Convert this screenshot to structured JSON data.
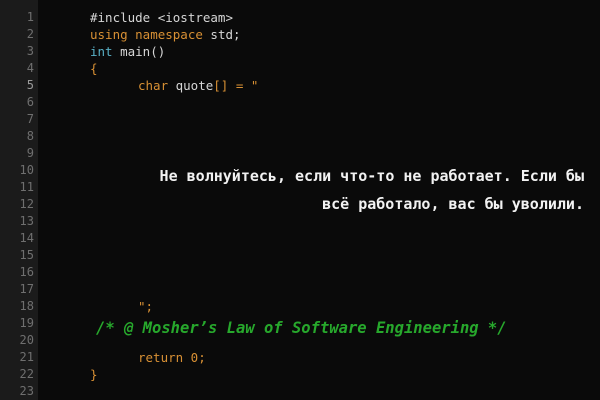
{
  "editor": {
    "line_numbers": [
      "1",
      "2",
      "3",
      "4",
      "5",
      "6",
      "7",
      "8",
      "9",
      "10",
      "11",
      "12",
      "13",
      "14",
      "15",
      "16",
      "17",
      "18",
      "19",
      "20",
      "21",
      "22",
      "23"
    ],
    "active_line": "5",
    "lines": {
      "l1": "#include <iostream>",
      "l2_kw": "using namespace",
      "l2_rest": " std;",
      "l3_type": "int",
      "l3_rest": " main()",
      "l4": "{",
      "l5_kw": "char",
      "l5_id": " quote",
      "l5_br": "[]",
      "l5_rest": " = \"",
      "l18": "\";",
      "l21": "return 0;",
      "l22": "}"
    }
  },
  "quote": {
    "line1": "Не волнуйтесь, если что-то не работает. Если бы",
    "line2": "всё работало, вас бы уволили."
  },
  "attribution": "/* @ Mosher’s Law of Software Engineering */",
  "colors": {
    "background": "#0a0a0a",
    "gutter": "#1b1b1b",
    "keyword": "#d89034",
    "type": "#59b0c6",
    "comment": "#27a82c",
    "text": "#f2f2f2"
  }
}
